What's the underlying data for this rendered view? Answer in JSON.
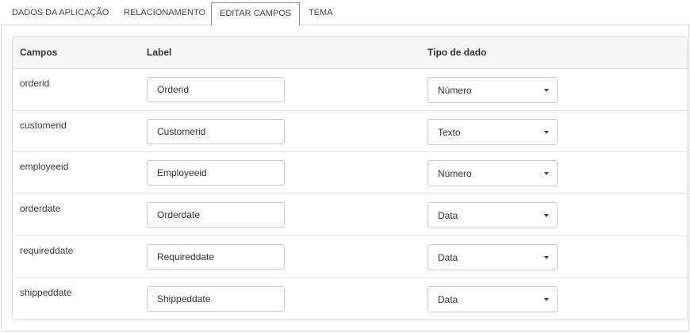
{
  "tabs": [
    {
      "label": "DADOS DA APLICAÇÃO",
      "active": false
    },
    {
      "label": "RELACIONAMENTO",
      "active": false
    },
    {
      "label": "EDITAR CAMPOS",
      "active": true
    },
    {
      "label": "TEMA",
      "active": false
    }
  ],
  "table": {
    "headers": {
      "campos": "Campos",
      "label": "Label",
      "tipo": "Tipo de dado"
    },
    "rows": [
      {
        "campo": "orderid",
        "label": "Orderid",
        "tipo": "Número"
      },
      {
        "campo": "customerid",
        "label": "Customerid",
        "tipo": "Texto"
      },
      {
        "campo": "employeeid",
        "label": "Employeeid",
        "tipo": "Número"
      },
      {
        "campo": "orderdate",
        "label": "Orderdate",
        "tipo": "Data"
      },
      {
        "campo": "requireddate",
        "label": "Requireddate",
        "tipo": "Data"
      },
      {
        "campo": "shippeddate",
        "label": "Shippeddate",
        "tipo": "Data"
      }
    ]
  },
  "icons": {
    "select_caret": "caret-down-icon"
  }
}
